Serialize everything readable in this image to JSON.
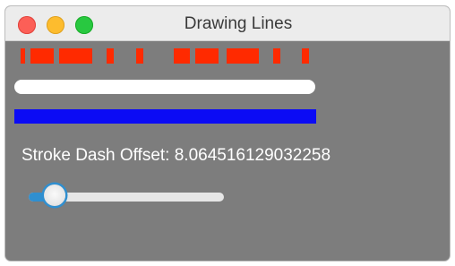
{
  "window": {
    "title": "Drawing Lines",
    "buttons": [
      "close",
      "minimize",
      "maximize"
    ]
  },
  "content": {
    "offset_label": "Stroke Dash Offset: 8.064516129032258",
    "slider_value": 8.064516129032258
  },
  "colors": {
    "background": "#7d7d7d",
    "dashed_line": "#ff2a00",
    "rounded_line": "#ffffff",
    "blue_line": "#0b0bf5",
    "slider_accent": "#2f8fd0"
  }
}
